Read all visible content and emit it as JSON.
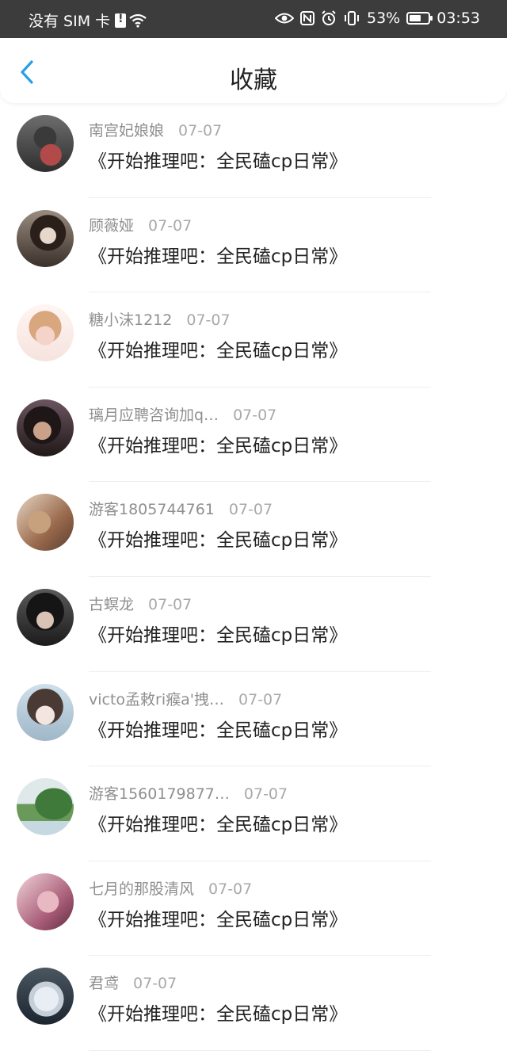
{
  "status_bar": {
    "carrier": "没有 SIM 卡",
    "battery_percent": "53%",
    "time": "03:53",
    "icons": [
      "sim-alert-icon",
      "wifi-icon",
      "eye-icon",
      "nfc-icon",
      "alarm-icon",
      "vibrate-icon",
      "battery-icon"
    ]
  },
  "header": {
    "title": "收藏",
    "back_icon": "chevron-left-icon",
    "accent_color": "#2a9fe6"
  },
  "items": [
    {
      "name": "南宫妃娘娘",
      "date": "07-07",
      "title": "《开始推理吧：全民磕cp日常》"
    },
    {
      "name": "顾薇娅",
      "date": "07-07",
      "title": "《开始推理吧：全民磕cp日常》"
    },
    {
      "name": "糖小沫1212",
      "date": "07-07",
      "title": "《开始推理吧：全民磕cp日常》"
    },
    {
      "name": "璃月应聘咨询加q…",
      "date": "07-07",
      "title": "《开始推理吧：全民磕cp日常》"
    },
    {
      "name": "游客1805744761",
      "date": "07-07",
      "title": "《开始推理吧：全民磕cp日常》"
    },
    {
      "name": "古螟龙",
      "date": "07-07",
      "title": "《开始推理吧：全民磕cp日常》"
    },
    {
      "name": "victo孟敕ri瘊a'拽…",
      "date": "07-07",
      "title": "《开始推理吧：全民磕cp日常》"
    },
    {
      "name": "游客1560179877…",
      "date": "07-07",
      "title": "《开始推理吧：全民磕cp日常》"
    },
    {
      "name": "七月的那股清风",
      "date": "07-07",
      "title": "《开始推理吧：全民磕cp日常》"
    },
    {
      "name": "君鸢",
      "date": "07-07",
      "title": "《开始推理吧：全民磕cp日常》"
    }
  ]
}
